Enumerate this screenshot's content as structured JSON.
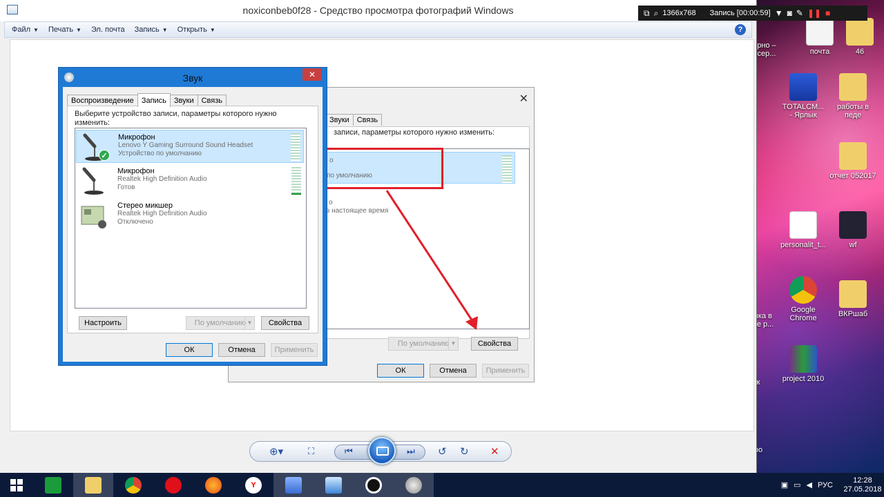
{
  "viewer": {
    "title": "noxiconbeb0f28 - Средство просмотра фотографий Windows",
    "menu": [
      "Файл",
      "Печать",
      "Эл. почта",
      "Запись",
      "Открыть"
    ]
  },
  "recorder": {
    "resolution": "1366x768",
    "status": "Запись [00:00:59]"
  },
  "dialog_back": {
    "tabs": [
      "Звуки",
      "Связь"
    ],
    "instruction": "записи, параметры которого нужно изменить:",
    "dev1_line": "о",
    "dev1_sub": "по умолчанию",
    "dev2_line": "о",
    "dev2_sub": "в настоящее время",
    "default_btn": "По умолчанию",
    "props_btn": "Свойства",
    "ok": "ОК",
    "cancel": "Отмена",
    "apply": "Применить"
  },
  "sound": {
    "title": "Звук",
    "tabs": [
      "Воспроизведение",
      "Запись",
      "Звуки",
      "Связь"
    ],
    "instruction": "Выберите устройство записи, параметры которого нужно изменить:",
    "devices": [
      {
        "name": "Микрофон",
        "desc": "Lenovo Y Gaming Surround Sound Headset",
        "status": "Устройство по умолчанию"
      },
      {
        "name": "Микрофон",
        "desc": "Realtek High Definition Audio",
        "status": "Готов"
      },
      {
        "name": "Стерео микшер",
        "desc": "Realtek High Definition Audio",
        "status": "Отключено"
      }
    ],
    "configure": "Настроить",
    "set_default": "По умолчанию",
    "properties": "Свойства",
    "ok": "ОК",
    "cancel": "Отмена",
    "apply": "Применить"
  },
  "desktop": {
    "icons": [
      {
        "label": "почта"
      },
      {
        "label": "46"
      },
      {
        "label": "рно –\nсер..."
      },
      {
        "label": "TOTALCM...\n- Ярлык"
      },
      {
        "label": "работы в\nпеде"
      },
      {
        "label": "отчет 052017"
      },
      {
        "label": "personalit_t..."
      },
      {
        "label": "wf"
      },
      {
        "label": "Google\nChrome"
      },
      {
        "label": "ВКРшаб"
      },
      {
        "label": "вка в\nре р..."
      },
      {
        "label": "project 2010"
      },
      {
        "label": "к"
      },
      {
        "label": "ро"
      }
    ]
  },
  "taskbar": {
    "lang": "РУС",
    "time": "12:28",
    "date": "27.05.2018"
  }
}
